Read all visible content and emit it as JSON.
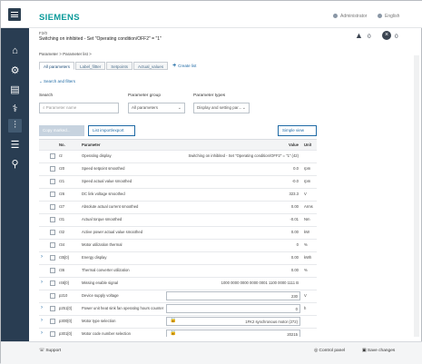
{
  "header": {
    "logo": "SIEMENS",
    "user": "Administrator",
    "language": "English"
  },
  "alarm": {
    "code": "F2/0",
    "text": "Switching on inhibited - Set \"Operating condition/OFF2\" = \"1\"",
    "warnings": "0",
    "faults": "0"
  },
  "breadcrumb": "Parameter  >  Parameter list  >",
  "tabs": [
    "All parameters",
    "Label_filtter",
    "Setpoints",
    "Actual_values"
  ],
  "create_list": "Create list",
  "search": {
    "header": "Search and filters",
    "label": "Search",
    "placeholder": "Parameter name",
    "group_label": "Parameter group",
    "group_value": "All parameters",
    "type_label": "Parameter types",
    "type_value": "Display and setting par..."
  },
  "buttons": {
    "copy": "Copy marked...",
    "import": "List import/export",
    "simple": "Simple view"
  },
  "table": {
    "headers": {
      "no": "No.",
      "param": "Parameter",
      "value": "Value",
      "unit": "Unit"
    },
    "rows": [
      {
        "no": "r2",
        "param": "Operating display",
        "value": "Switching on inhibited - Set \"Operating condition/OFF2\" = \"1\" (42)",
        "unit": ""
      },
      {
        "no": "r20",
        "param": "Speed setpoint smoothed",
        "value": "0.0",
        "unit": "rpm"
      },
      {
        "no": "r21",
        "param": "Speed actual value smoothed",
        "value": "-0.0",
        "unit": "rpm"
      },
      {
        "no": "r26",
        "param": "DC link voltage smoothed",
        "value": "323.3",
        "unit": "V"
      },
      {
        "no": "r27",
        "param": "Absolute actual current smoothed",
        "value": "0.00",
        "unit": "Arms"
      },
      {
        "no": "r31",
        "param": "Actual torque smoothed",
        "value": "-0.01",
        "unit": "Nm"
      },
      {
        "no": "r32",
        "param": "Active power actual value smoothed",
        "value": "0.00",
        "unit": "kW"
      },
      {
        "no": "r34",
        "param": "Motor utilization thermal",
        "value": "0",
        "unit": "%"
      },
      {
        "no": "r35[0]",
        "param": "Energy display",
        "value": "0.00",
        "unit": "kWh"
      },
      {
        "no": "r36",
        "param": "Thermal converter utilization",
        "value": "0.00",
        "unit": "%"
      },
      {
        "no": "r46[0]",
        "param": "Missing enable signal",
        "value": "1000 0000 0000 0000 0001 1100 0000 1111 B",
        "unit": ""
      },
      {
        "no": "p210",
        "param": "Device supply voltage",
        "value": "230",
        "unit": "V"
      },
      {
        "no": "p251[0]",
        "param": "Power unit heat sink fan operating hours counter",
        "value": "0",
        "unit": "h"
      },
      {
        "no": "p300[0]",
        "param": "Motor type selection",
        "value": "1FK2 synchronous motor (272)",
        "unit": ""
      },
      {
        "no": "p301[0]",
        "param": "Motor code number selection",
        "value": "20215",
        "unit": ""
      }
    ]
  },
  "footer": {
    "support": "Support",
    "control": "Control panel",
    "save": "Save changes"
  }
}
